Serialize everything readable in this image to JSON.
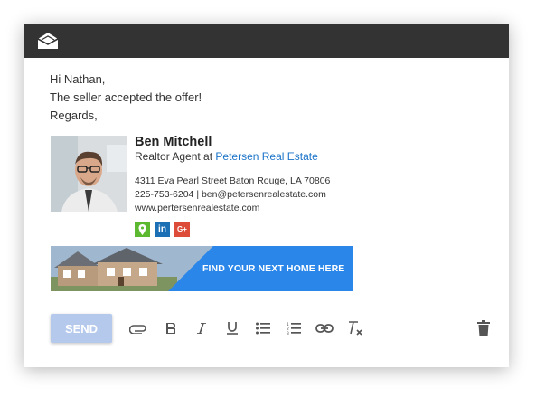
{
  "email": {
    "greeting": "Hi Nathan,",
    "message": "The seller accepted the offer!",
    "closing": "Regards,"
  },
  "signature": {
    "name": "Ben Mitchell",
    "title_prefix": "Realtor Agent at",
    "company": "Petersen Real Estate",
    "address": "4311 Eva Pearl Street Baton Rouge, LA 70806",
    "phone": "225-753-6204",
    "separator": "|",
    "email": "ben@petersenrealestate.com",
    "website": "www.pertersenrealestate.com",
    "social": [
      {
        "icon": "map-pin-icon",
        "label": "",
        "color": "#5cb82e"
      },
      {
        "icon": "linkedin-icon",
        "label": "in",
        "color": "#1a6fb5"
      },
      {
        "icon": "google-plus-icon",
        "label": "G+",
        "color": "#dd4b39"
      }
    ],
    "banner_cta": "FIND YOUR NEXT HOME HERE",
    "banner_color": "#2b86ea"
  },
  "toolbar": {
    "send_label": "SEND",
    "icons": [
      "attach-icon",
      "bold-icon",
      "italic-icon",
      "underline-icon",
      "bulleted-list-icon",
      "numbered-list-icon",
      "link-icon",
      "clear-format-icon",
      "trash-icon"
    ]
  },
  "colors": {
    "titlebar": "#333333",
    "send_button": "#b4c9ec",
    "link": "#1a73c8"
  }
}
